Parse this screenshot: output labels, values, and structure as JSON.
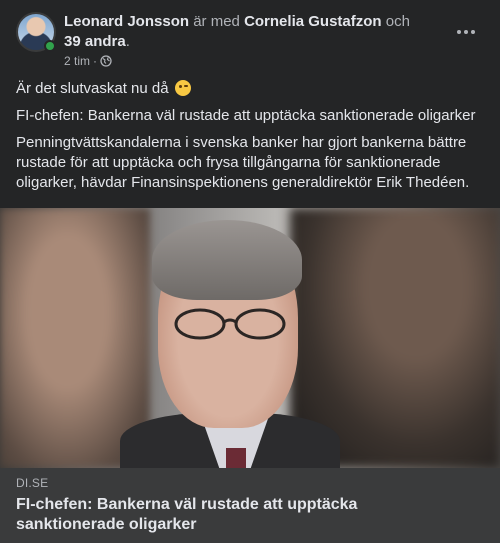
{
  "post": {
    "author": "Leonard Jonsson",
    "with_text": "är med",
    "tagged": "Cornelia Gustafzon",
    "and_text": "och",
    "others": "39 andra",
    "period": ".",
    "time": "2 tim",
    "separator": "·",
    "privacy_icon": "globe-icon",
    "more_icon": "more-options-icon",
    "status_text": "Är det slutvaskat nu då",
    "emoji": "winking-face-emoji",
    "headline": "FI-chefen: Bankerna väl rustade att upptäcka sanktionerade oligarker",
    "summary": "Penningtvättskandalerna i svenska banker har gjort bankerna bättre rustade för att upptäcka och frysa tillgångarna för sanktionerade oligarker, hävdar Finansinspektionens generaldirektör Erik Thedéen."
  },
  "link_preview": {
    "domain": "DI.SE",
    "title": "FI-chefen: Bankerna väl rustade att upptäcka sanktionerade oligarker"
  },
  "colors": {
    "background": "#242526",
    "link_box": "#3a3b3c",
    "primary_text": "#e4e6eb",
    "secondary_text": "#b0b3b8",
    "online": "#31a24c"
  }
}
